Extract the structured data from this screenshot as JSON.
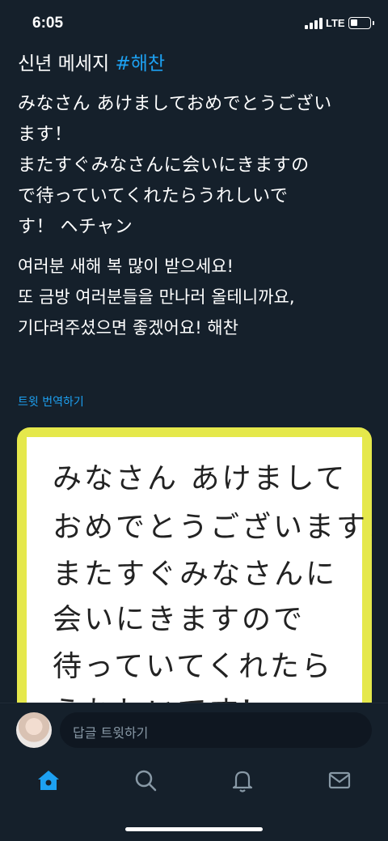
{
  "status_bar": {
    "time": "6:05",
    "network": "LTE"
  },
  "tweet": {
    "title_prefix": "신년 메세지 ",
    "hashtag": "#해찬",
    "text_jp": "みなさん あけましておめでとうござい\nます！\nまたすぐみなさんに会いにきますの\nで待っていてくれたらうれしいで\nす！ ヘチャン",
    "text_kr": "여러분 새해 복 많이 받으세요!\n또 금방 여러분들을 만나러 올테니까요,\n기다려주셨으면 좋겠어요! 해찬",
    "translate_label": "트윗 번역하기"
  },
  "image": {
    "handwriting_lines": [
      "みなさん あけまして",
      "おめでとうございます!",
      "またすぐみなさんに",
      "会いにきますので",
      "待っていてくれたら",
      "うれしいです!"
    ],
    "border_color": "#e5e84b"
  },
  "reply": {
    "placeholder": "답글 트윗하기"
  },
  "tabs": {
    "home_icon": "home-icon",
    "search_icon": "search-icon",
    "notifications_icon": "bell-icon",
    "messages_icon": "mail-icon"
  },
  "colors": {
    "background": "#15202b",
    "accent": "#1da1f2"
  }
}
